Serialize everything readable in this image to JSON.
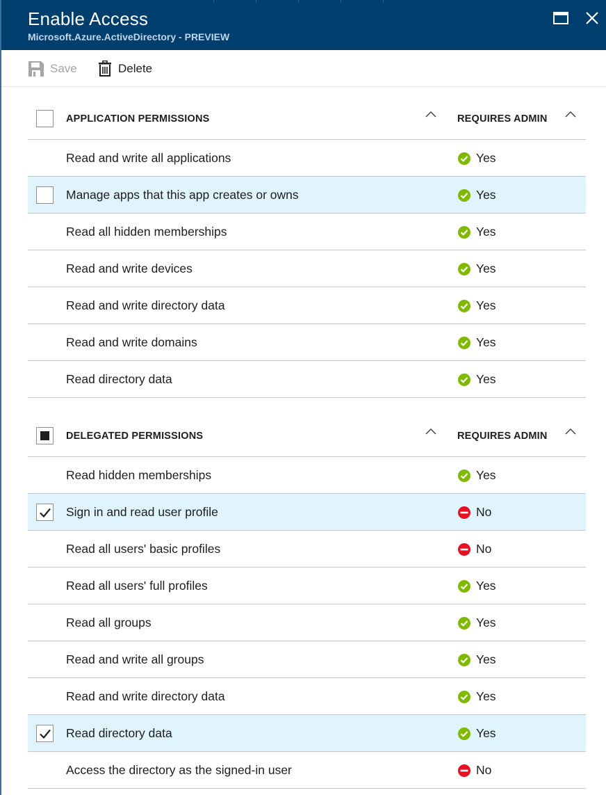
{
  "header": {
    "title": "Enable Access",
    "subtitle": "Microsoft.Azure.ActiveDirectory - PREVIEW"
  },
  "toolbar": {
    "save_label": "Save",
    "delete_label": "Delete"
  },
  "colors": {
    "header_bg": "#003e6e",
    "selected_row": "#dff4fc",
    "yes_green": "#7fba00",
    "no_red": "#e81123"
  },
  "application_permissions": {
    "column_label": "APPLICATION PERMISSIONS",
    "admin_column_label": "REQUIRES ADMIN",
    "header_checkbox": "unchecked",
    "rows": [
      {
        "name": "Read and write all applications",
        "requires_admin": "Yes",
        "checkbox": "none",
        "selected": false
      },
      {
        "name": "Manage apps that this app creates or owns",
        "requires_admin": "Yes",
        "checkbox": "unchecked",
        "selected": true
      },
      {
        "name": "Read all hidden memberships",
        "requires_admin": "Yes",
        "checkbox": "none",
        "selected": false
      },
      {
        "name": "Read and write devices",
        "requires_admin": "Yes",
        "checkbox": "none",
        "selected": false
      },
      {
        "name": "Read and write directory data",
        "requires_admin": "Yes",
        "checkbox": "none",
        "selected": false
      },
      {
        "name": "Read and write domains",
        "requires_admin": "Yes",
        "checkbox": "none",
        "selected": false
      },
      {
        "name": "Read directory data",
        "requires_admin": "Yes",
        "checkbox": "none",
        "selected": false
      }
    ]
  },
  "delegated_permissions": {
    "column_label": "DELEGATED PERMISSIONS",
    "admin_column_label": "REQUIRES ADMIN",
    "header_checkbox": "partial",
    "rows": [
      {
        "name": "Read hidden memberships",
        "requires_admin": "Yes",
        "checkbox": "none",
        "selected": false
      },
      {
        "name": "Sign in and read user profile",
        "requires_admin": "No",
        "checkbox": "checked",
        "selected": true
      },
      {
        "name": "Read all users' basic profiles",
        "requires_admin": "No",
        "checkbox": "none",
        "selected": false
      },
      {
        "name": "Read all users' full profiles",
        "requires_admin": "Yes",
        "checkbox": "none",
        "selected": false
      },
      {
        "name": "Read all groups",
        "requires_admin": "Yes",
        "checkbox": "none",
        "selected": false
      },
      {
        "name": "Read and write all groups",
        "requires_admin": "Yes",
        "checkbox": "none",
        "selected": false
      },
      {
        "name": "Read and write directory data",
        "requires_admin": "Yes",
        "checkbox": "none",
        "selected": false
      },
      {
        "name": "Read directory data",
        "requires_admin": "Yes",
        "checkbox": "checked",
        "selected": true
      },
      {
        "name": "Access the directory as the signed-in user",
        "requires_admin": "No",
        "checkbox": "none",
        "selected": false
      }
    ]
  }
}
